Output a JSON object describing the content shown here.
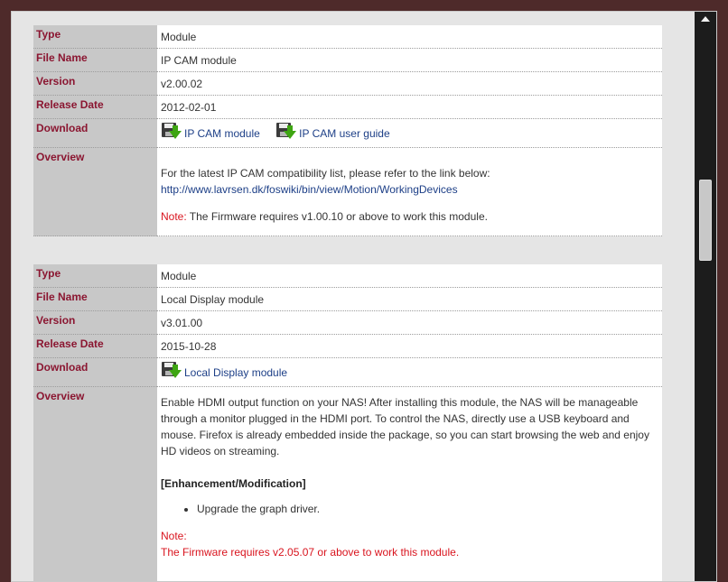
{
  "modules": [
    {
      "rows": {
        "type_label": "Type",
        "type_value": "Module",
        "filename_label": "File Name",
        "filename_value": "IP CAM module",
        "version_label": "Version",
        "version_value": "v2.00.02",
        "release_label": "Release Date",
        "release_value": "2012-02-01",
        "download_label": "Download",
        "overview_label": "Overview"
      },
      "downloads": [
        "IP CAM module",
        "IP CAM user guide"
      ],
      "overview": {
        "intro": "For the latest IP CAM compatibility list, please refer to the link below:",
        "link": "http://www.lavrsen.dk/foswiki/bin/view/Motion/WorkingDevices",
        "note_label": "Note:",
        "note_text": " The Firmware requires v1.00.10 or above to work this module."
      }
    },
    {
      "rows": {
        "type_label": "Type",
        "type_value": "Module",
        "filename_label": "File Name",
        "filename_value": "Local Display module",
        "version_label": "Version",
        "version_value": "v3.01.00",
        "release_label": "Release Date",
        "release_value": "2015-10-28",
        "download_label": "Download",
        "overview_label": "Overview"
      },
      "downloads": [
        "Local Display module"
      ],
      "overview": {
        "intro": "Enable HDMI output function on your NAS! After installing this module, the NAS will be manageable through a monitor plugged in the HDMI port. To control the NAS, directly use a USB keyboard and mouse. Firefox is already embedded inside the package, so you can start browsing the web and enjoy HD videos on streaming.",
        "section_title": "[Enhancement/Modification]",
        "bullets": [
          "Upgrade the graph driver."
        ],
        "note_label": "Note:",
        "note_text": "The Firmware requires v2.05.07 or above to work this module."
      }
    }
  ],
  "icons": {
    "download": "floppy-download-icon",
    "scroll_up": "scroll-up-arrow-icon"
  },
  "colors": {
    "label_text": "#8b1631",
    "label_bg": "#c8c8c8",
    "link": "#1d3f87",
    "note": "#d9141e"
  }
}
